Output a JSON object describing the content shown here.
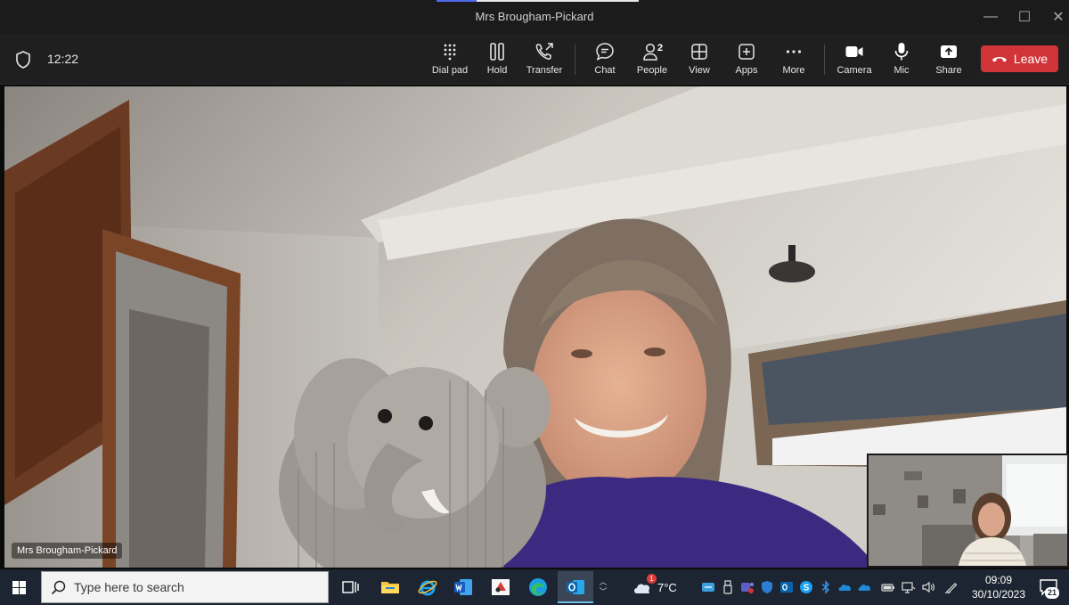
{
  "window": {
    "title": "Mrs Brougham-Pickard",
    "controls": [
      {
        "name": "minimize-icon",
        "glyph": "—"
      },
      {
        "name": "maximize-icon",
        "glyph": "☐"
      },
      {
        "name": "close-icon",
        "glyph": "✕"
      }
    ]
  },
  "toolbar": {
    "time": "12:22",
    "buttons": [
      {
        "id": "dial-pad",
        "label": "Dial pad",
        "icon": "dialpad-icon"
      },
      {
        "id": "hold",
        "label": "Hold",
        "icon": "pause-icon"
      },
      {
        "id": "transfer",
        "label": "Transfer",
        "icon": "phone-transfer-icon"
      },
      {
        "id": "chat",
        "label": "Chat",
        "icon": "chat-icon"
      },
      {
        "id": "people",
        "label": "People",
        "icon": "people-icon",
        "count": "2"
      },
      {
        "id": "view",
        "label": "View",
        "icon": "grid-view-icon"
      },
      {
        "id": "apps",
        "label": "Apps",
        "icon": "plus-square-icon"
      },
      {
        "id": "more",
        "label": "More",
        "icon": "ellipsis-icon"
      },
      {
        "id": "camera",
        "label": "Camera",
        "icon": "camera-icon"
      },
      {
        "id": "mic",
        "label": "Mic",
        "icon": "mic-icon"
      },
      {
        "id": "share",
        "label": "Share",
        "icon": "share-tray-icon"
      }
    ],
    "leave_label": "Leave",
    "leave_color": "#d13438"
  },
  "video": {
    "participant_name": "Mrs Brougham-Pickard"
  },
  "taskbar": {
    "search_placeholder": "Type here to search",
    "apps": [
      "task-view-icon",
      "file-explorer-icon",
      "internet-explorer-icon",
      "word-icon",
      "paint-icon",
      "edge-icon",
      "outlook-icon"
    ],
    "weather": {
      "temp": "7°C",
      "badge": "1"
    },
    "time": "09:09",
    "date": "30/10/2023",
    "notification_count": "21",
    "accent": "#76b9ed"
  }
}
